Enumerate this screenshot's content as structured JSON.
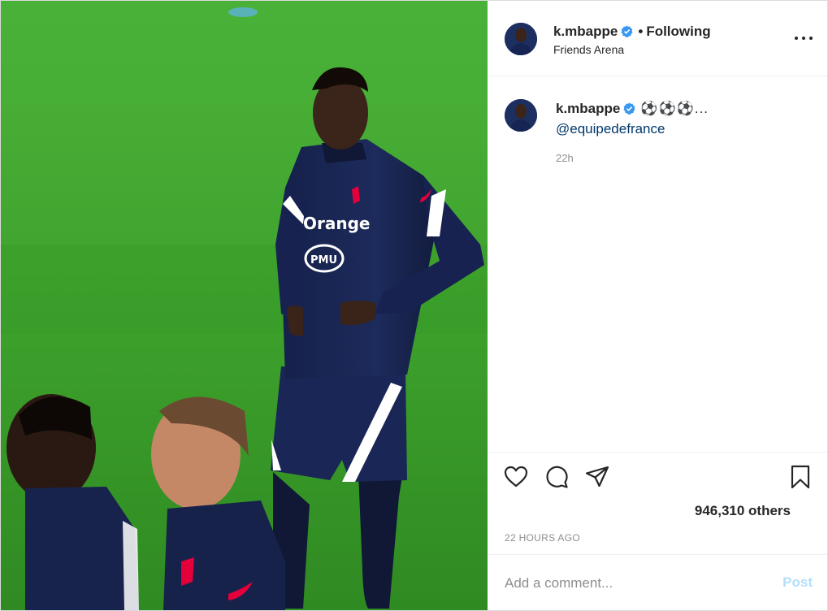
{
  "post": {
    "image_alt": "Kylian Mbappé in France training kit on a football pitch",
    "shirt_sponsor": "Orange",
    "shirt_badge": "PMU"
  },
  "header": {
    "username": "k.mbappe",
    "separator": "•",
    "follow_label": "Following",
    "location": "Friends Arena"
  },
  "caption": {
    "username": "k.mbappe",
    "emojis": "⚽⚽⚽...",
    "mention": "@equipedefrance",
    "time_ago": "22h"
  },
  "actions": {
    "likes_text": "946,310 others",
    "date_text": "22 HOURS AGO"
  },
  "comment_box": {
    "placeholder": "Add a comment...",
    "post_label": "Post"
  },
  "colors": {
    "verified": "#3897f0",
    "link": "#00376b",
    "post_disabled": "#b2dffc",
    "muted": "#8e8e8e"
  },
  "icons": [
    "verified-icon",
    "more-options-icon",
    "heart-icon",
    "comment-icon",
    "share-icon",
    "bookmark-icon"
  ]
}
